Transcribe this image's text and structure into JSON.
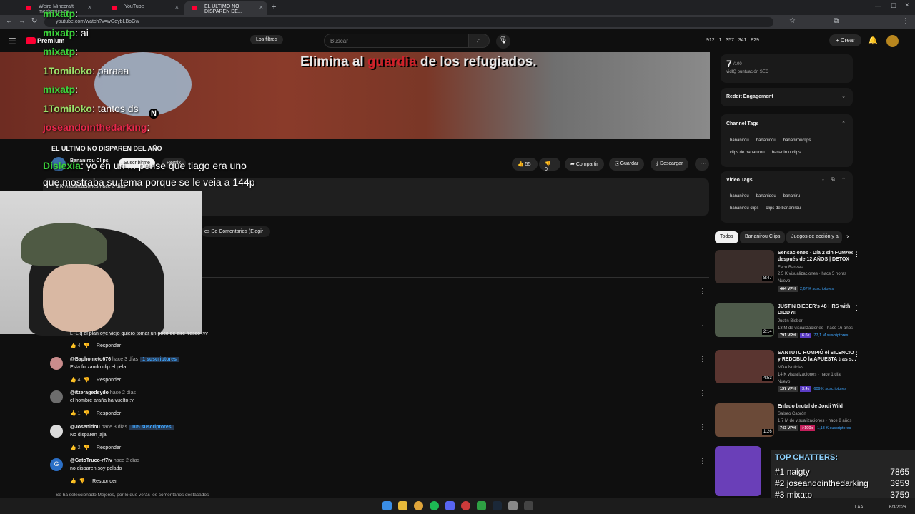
{
  "browser": {
    "tabs": [
      {
        "label": "Weird Minecraft mechanics ex..."
      },
      {
        "label": "YouTube"
      },
      {
        "label": "EL ULTIMO NO DISPAREN DE..."
      }
    ],
    "url": "youtube.com/watch?v=wGdybLBoGw"
  },
  "youtube": {
    "logo": "Premium",
    "filter_label": "Los filtros",
    "search_placeholder": "Buscar",
    "stats": "912   1   357   341   829",
    "create_label": "Crear"
  },
  "video": {
    "subtitle_pre": "Elimina al ",
    "subtitle_red": "guardia",
    "subtitle_post": " de los refugiados.",
    "minimap_letter": "N",
    "title": "EL ULTIMO NO DISPAREN DEL AÑO",
    "channel": "Bananirou Clips",
    "subscribe": "Suscribirme",
    "remix": "Remix",
    "views": "1 K visualizaciones   hace 3 días",
    "likes": "55",
    "dislikes": "0",
    "share": "Compartir",
    "save": "Guardar",
    "download": "Descargar"
  },
  "chat_overlay": [
    {
      "user": "mixatp",
      "msg": "",
      "color": "#3bd33b"
    },
    {
      "user": "mixatp",
      "msg": " ai",
      "color": "#3bd33b"
    },
    {
      "user": "mixatp",
      "msg": "",
      "color": "#3bd33b"
    },
    {
      "user": "1Tomiloko",
      "msg": " paraaa",
      "color": "#9be16a"
    },
    {
      "user": "mixatp",
      "msg": "",
      "color": "#3bd33b"
    },
    {
      "user": "1Tomiloko",
      "msg": " tantos ds",
      "color": "#9be16a"
    },
    {
      "user": "joseandointhedarking",
      "msg": "",
      "color": "#e8274b"
    },
    {
      "user": "Dislexia",
      "msg": " yo en un ... pense que tiago era uno",
      "color": "#3bd33b"
    },
    {
      "user": "",
      "msg": "que mostraba su tema porque se le veia a 144p",
      "color": "#ffffff"
    }
  ],
  "comments_sort": "es De Comentarios (Elegir",
  "comments": [
    {
      "name": "",
      "time": "",
      "badge": "",
      "text": "L -L q el plan oye viejo quiero tomar un poco de aire fresco :vv",
      "likes": "4",
      "reply": "Responder",
      "avatar": "#555"
    },
    {
      "name": "@Baphometo676",
      "time": " hace 3 días",
      "badge": "1 suscriptores",
      "text": "Esta forzando clip el pela",
      "likes": "4",
      "reply": "Responder",
      "avatar": "#c98c8c"
    },
    {
      "name": "@itzeragedsydo",
      "time": " hace 2 días",
      "badge": "",
      "text": "el hombre araña ha vuelto :v",
      "likes": "1",
      "reply": "Responder",
      "avatar": "#6d6d6d"
    },
    {
      "name": "@Josenidou",
      "time": " hace 3 días",
      "badge": "105 suscriptores",
      "text": "No disparen jaja",
      "likes": "2",
      "reply": "Responder",
      "avatar": "#dcdcdc"
    },
    {
      "name": "@GatoTruco-rf7iv",
      "time": " hace 2 días",
      "badge": "",
      "text": "no disparen soy pelado",
      "likes": "",
      "reply": "Responder",
      "avatar": "#2b6fc6",
      "letter": "G"
    }
  ],
  "comments_footer": "Se ha seleccionado Mejores, por lo que verás los comentarios destacados",
  "seo": {
    "score": "7",
    "of": "/100",
    "label": "vidIQ puntuación SEO"
  },
  "reddit": {
    "title": "Reddit Engagement"
  },
  "channel_tags": {
    "title": "Channel Tags",
    "tags": [
      "bananirou",
      "bananidou",
      "bananirouclips",
      "clips de bananirou",
      "bananirou clips"
    ]
  },
  "video_tags": {
    "title": "Video Tags",
    "tags": [
      "bananirou",
      "bananidou",
      "bananiru",
      "bananirou clips",
      "clips de bananirou"
    ]
  },
  "chips": [
    "Todos",
    "Bananirou Clips",
    "Juegos de acción y a"
  ],
  "recommendations": [
    {
      "title": "Sensaciones - Día 2 sin FUMAR después de 12 AÑOS | DETOX",
      "channel": "Facu Banzas",
      "meta": "2,5 K visualizaciones · hace 5 horas",
      "extra": "Nuevo",
      "vph": "464 VPH",
      "mult": "",
      "subs": "2,67 K suscriptores",
      "duration": "8:47",
      "thumb": "#3a2d2a"
    },
    {
      "title": "JUSTIN BIEBER's 48 HRS with DIDDY!!",
      "channel": "Justin Bieber",
      "meta": "13 M de visualizaciones · hace 16 años",
      "extra": "",
      "vph": "791 VPH",
      "mult": "6.6x",
      "subs": "77,1 M suscriptores",
      "duration": "2:14",
      "thumb": "#4e5a4a"
    },
    {
      "title": "SANTUTU ROMPIÓ el SILENCIO y REDOBLÓ la APUESTA tras s...",
      "channel": "MDA Noticias",
      "meta": "14 K visualizaciones · hace 1 día",
      "extra": "Nuevo",
      "vph": "137 VPH",
      "mult": "3.4x",
      "subs": "609 K suscriptores",
      "duration": "4:53",
      "thumb": "#5a3530"
    },
    {
      "title": "Enfado brutal de Jordi Wild",
      "channel": "Salseo Cabrón",
      "meta": "1,7 M de visualizaciones · hace 8 años",
      "extra": "",
      "vph": "743 VPH",
      "mult": ">100x",
      "subs": "1,13 K suscriptores",
      "duration": "1:26",
      "thumb": "#6b4a38"
    },
    {
      "title": "",
      "channel": "",
      "meta": "",
      "extra": "",
      "vph": "",
      "mult": "",
      "subs": "",
      "duration": "",
      "thumb": "#6a3fb8"
    }
  ],
  "top_chatters": {
    "title": "TOP CHATTERS:",
    "rows": [
      {
        "rank": "#1",
        "name": "naigty",
        "count": "7865"
      },
      {
        "rank": "#2",
        "name": "joseandointhedarking",
        "count": "3959"
      },
      {
        "rank": "#3",
        "name": "mixatp",
        "count": "3759"
      }
    ]
  },
  "taskbar": {
    "lang": "LAA",
    "date": "6/3/2026"
  },
  "colors": {
    "accent": "#3ea6ff",
    "brand": "#ff0033"
  }
}
